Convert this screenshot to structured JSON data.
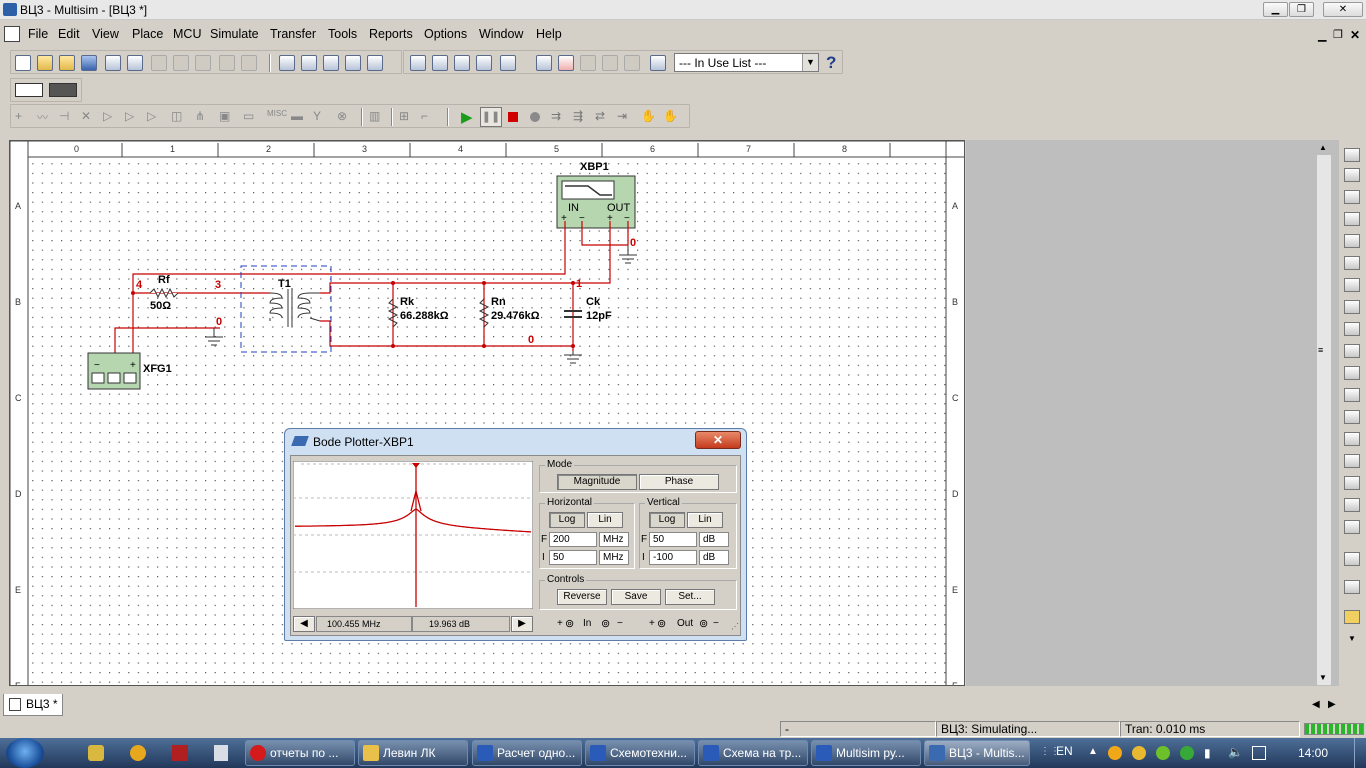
{
  "window": {
    "title": "ВЦ3 - Multisim - [ВЦ3 *]"
  },
  "menu": [
    "File",
    "Edit",
    "View",
    "Place",
    "MCU",
    "Simulate",
    "Transfer",
    "Tools",
    "Reports",
    "Options",
    "Window",
    "Help"
  ],
  "toolbar": {
    "in_use_list": "--- In Use List ---",
    "help": "?"
  },
  "ruler": {
    "columns": [
      "0",
      "1",
      "2",
      "3",
      "4",
      "5",
      "6",
      "7",
      "8"
    ],
    "rows": [
      "A",
      "B",
      "C",
      "D",
      "E",
      "F"
    ]
  },
  "schematic": {
    "instrument_bode": {
      "ref": "XBP1",
      "in": "IN",
      "out": "OUT"
    },
    "instrument_fg": {
      "ref": "XFG1"
    },
    "rf": {
      "ref": "Rf",
      "value": "50Ω"
    },
    "t1": {
      "ref": "T1"
    },
    "rk": {
      "ref": "Rk",
      "value": "66.288kΩ"
    },
    "rn": {
      "ref": "Rn",
      "value": "29.476kΩ"
    },
    "ck": {
      "ref": "Ck",
      "value": "12pF"
    },
    "nets": {
      "n4": "4",
      "n3": "3",
      "n1": "1",
      "n0a": "0",
      "n0b": "0",
      "n0c": "0"
    },
    "signs": {
      "plus": "+",
      "minus": "−"
    }
  },
  "bode": {
    "title": "Bode Plotter-XBP1",
    "mode_label": "Mode",
    "magnitude": "Magnitude",
    "phase": "Phase",
    "horizontal_label": "Horizontal",
    "vertical_label": "Vertical",
    "log": "Log",
    "lin": "Lin",
    "f_label": "F",
    "i_label": "I",
    "h_f": "200",
    "h_f_unit": "MHz",
    "h_i": "50",
    "h_i_unit": "MHz",
    "v_f": "50",
    "v_f_unit": "dB",
    "v_i": "-100",
    "v_i_unit": "dB",
    "controls_label": "Controls",
    "reverse": "Reverse",
    "save": "Save",
    "set": "Set...",
    "cursor_freq": "100.455 MHz",
    "cursor_gain": "19.963 dB",
    "in_label": "In",
    "out_label": "Out",
    "term_plus": "+",
    "term_minus": "−"
  },
  "tab": {
    "name": "ВЦ3 *"
  },
  "status": {
    "left": "-",
    "sim": "ВЦ3: Simulating...",
    "tran": "Tran: 0.010 ms"
  },
  "taskbar": {
    "lang": "EN",
    "time": "14:00",
    "tasks": [
      "отчеты по ...",
      "Левин ЛК",
      "Расчет одно...",
      "Схемотехни...",
      "Схема на тр...",
      "Multisim ру...",
      "ВЦ3 - Multis..."
    ]
  },
  "colors": {
    "wire": "#c80000",
    "instrument": "#b6d6b0",
    "accent": "#1f5fb4"
  }
}
